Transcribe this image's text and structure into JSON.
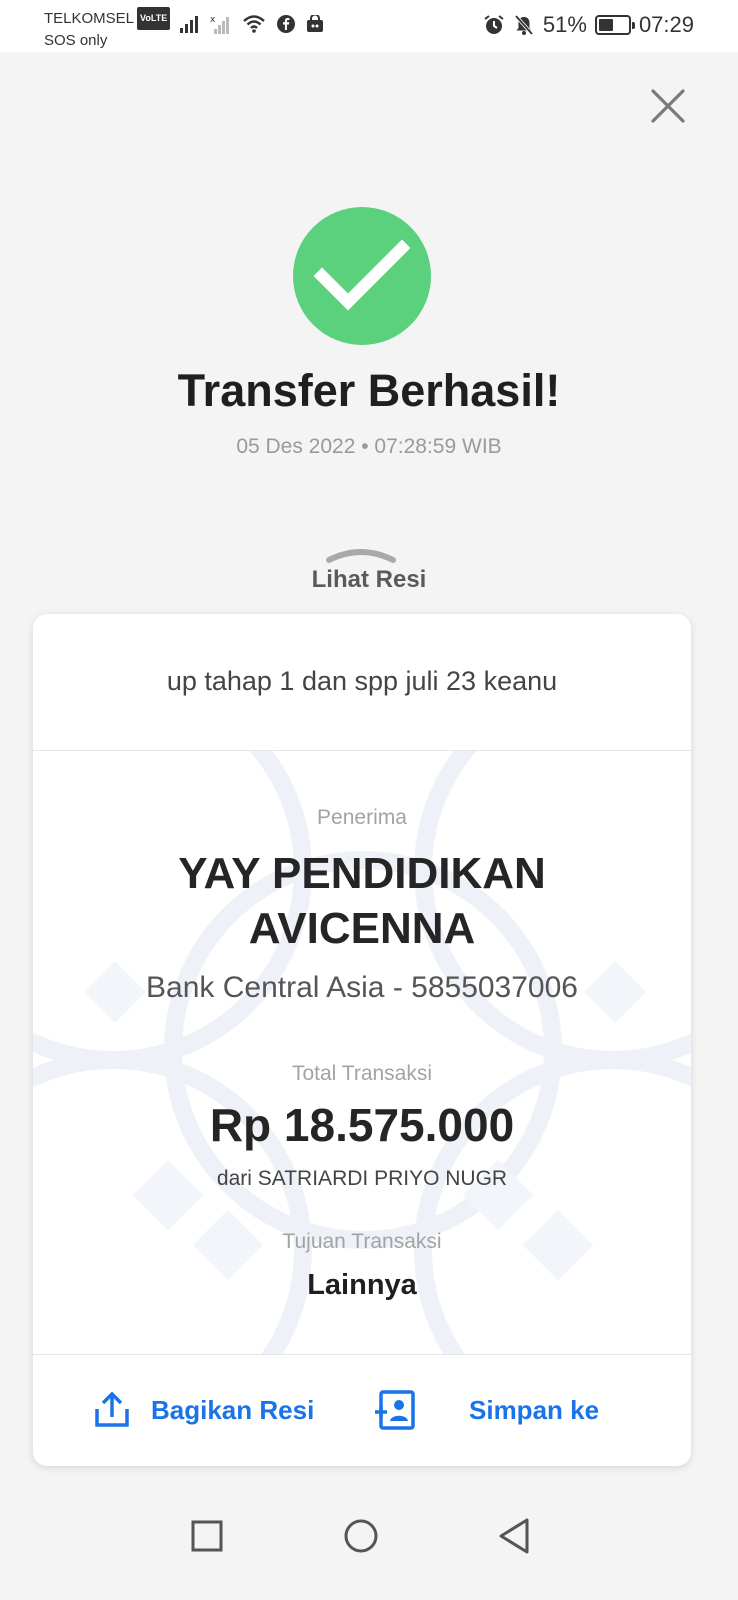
{
  "status_bar": {
    "carrier": "TELKOMSEL",
    "volte": "VoLTE",
    "sos": "SOS only",
    "battery": "51%",
    "battery_level": 0.51,
    "time": "07:29"
  },
  "header": {
    "title": "Transfer Berhasil!",
    "datetime": "05 Des 2022 • 07:28:59 WIB",
    "receipt_toggle": "Lihat Resi"
  },
  "receipt": {
    "note": "up tahap 1 dan spp juli 23 keanu",
    "recipient_label": "Penerima",
    "recipient_name_line1": "YAY PENDIDIKAN",
    "recipient_name_line2": "AVICENNA",
    "bank_account": "Bank Central Asia - 5855037006",
    "total_label": "Total Transaksi",
    "amount": "Rp 18.575.000",
    "from": "dari SATRIARDI PRIYO NUGR",
    "purpose_label": "Tujuan Transaksi",
    "purpose": "Lainnya"
  },
  "actions": {
    "share": "Bagikan Resi",
    "save": "Simpan ke"
  },
  "colors": {
    "success": "#5bd17e",
    "accent": "#1a73e8"
  }
}
